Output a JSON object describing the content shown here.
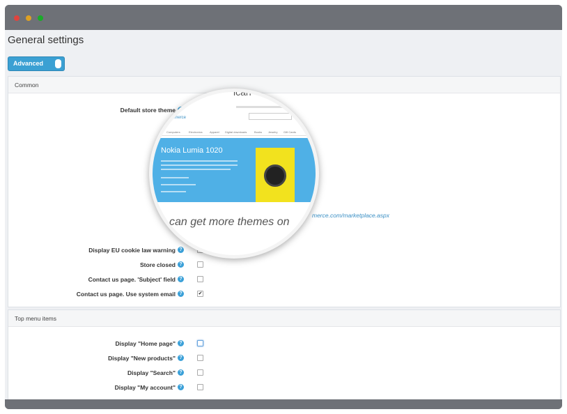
{
  "page": {
    "title": "General settings",
    "advanced_label": "Advanced"
  },
  "common": {
    "title": "Common",
    "default_theme_label": "Default store theme",
    "marketplace_link": "merce.com/marketplace.aspx",
    "magnifier": {
      "slide_title": "Nokia Lumia 1020",
      "footer_text": "can get more themes on",
      "top_text": "ican",
      "nav_items": [
        "Computers",
        "Electronics",
        "Apparel",
        "Digital downloads",
        "Books",
        "Jewelry",
        "Gift Cards"
      ]
    },
    "rows": [
      {
        "label": "Display EU cookie law warning",
        "checked": false
      },
      {
        "label": "Store closed",
        "checked": false
      },
      {
        "label": "Contact us page. 'Subject' field",
        "checked": false
      },
      {
        "label": "Contact us page. Use system email",
        "checked": true,
        "mark": "✔"
      }
    ]
  },
  "top_menu": {
    "title": "Top menu items",
    "rows": [
      {
        "label": "Display \"Home page\"",
        "checked": false
      },
      {
        "label": "Display \"New products\"",
        "checked": false
      },
      {
        "label": "Display \"Search\"",
        "checked": false
      },
      {
        "label": "Display \"My account\"",
        "checked": false
      }
    ]
  },
  "icons": {
    "help": "question-icon",
    "window_close": "red-dot",
    "window_minimize": "yellow-dot",
    "window_zoom": "green-dot"
  },
  "colors": {
    "accent": "#3ba0d3",
    "chrome": "#6e7177",
    "link": "#3a8fc4"
  }
}
